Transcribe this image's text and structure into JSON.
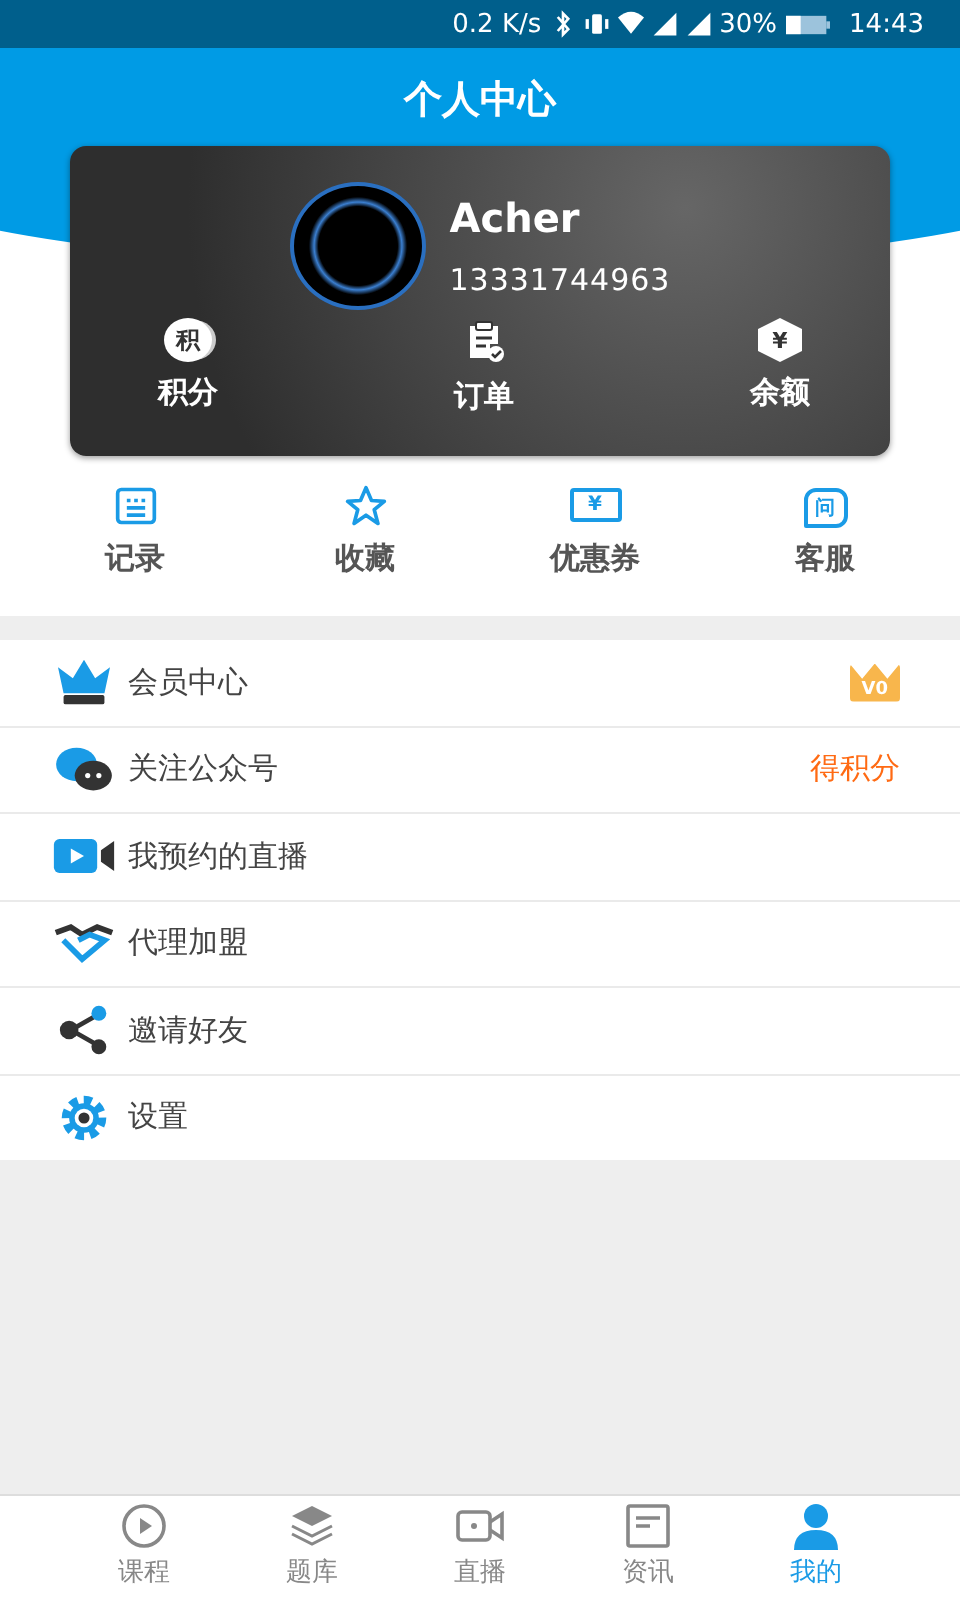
{
  "status_bar": {
    "speed": "0.2 K/s",
    "battery": "30%",
    "time": "14:43"
  },
  "header": {
    "title": "个人中心"
  },
  "profile": {
    "name": "Acher",
    "phone": "13331744963"
  },
  "profile_stats": [
    {
      "label": "积分",
      "icon_text": "积"
    },
    {
      "label": "订单"
    },
    {
      "label": "余额",
      "icon_text": "¥"
    }
  ],
  "shortcuts": [
    {
      "label": "记录"
    },
    {
      "label": "收藏"
    },
    {
      "label": "优惠券",
      "icon_text": "¥"
    },
    {
      "label": "客服",
      "icon_text": "问"
    }
  ],
  "menu": [
    {
      "label": "会员中心",
      "badge": "V0"
    },
    {
      "label": "关注公众号",
      "trailing": "得积分"
    },
    {
      "label": "我预约的直播"
    },
    {
      "label": "代理加盟"
    },
    {
      "label": "邀请好友"
    },
    {
      "label": "设置"
    }
  ],
  "tab_bar": [
    {
      "label": "课程",
      "selected": false
    },
    {
      "label": "题库",
      "selected": false
    },
    {
      "label": "直播",
      "selected": false
    },
    {
      "label": "资讯",
      "selected": false
    },
    {
      "label": "我的",
      "selected": true
    }
  ]
}
